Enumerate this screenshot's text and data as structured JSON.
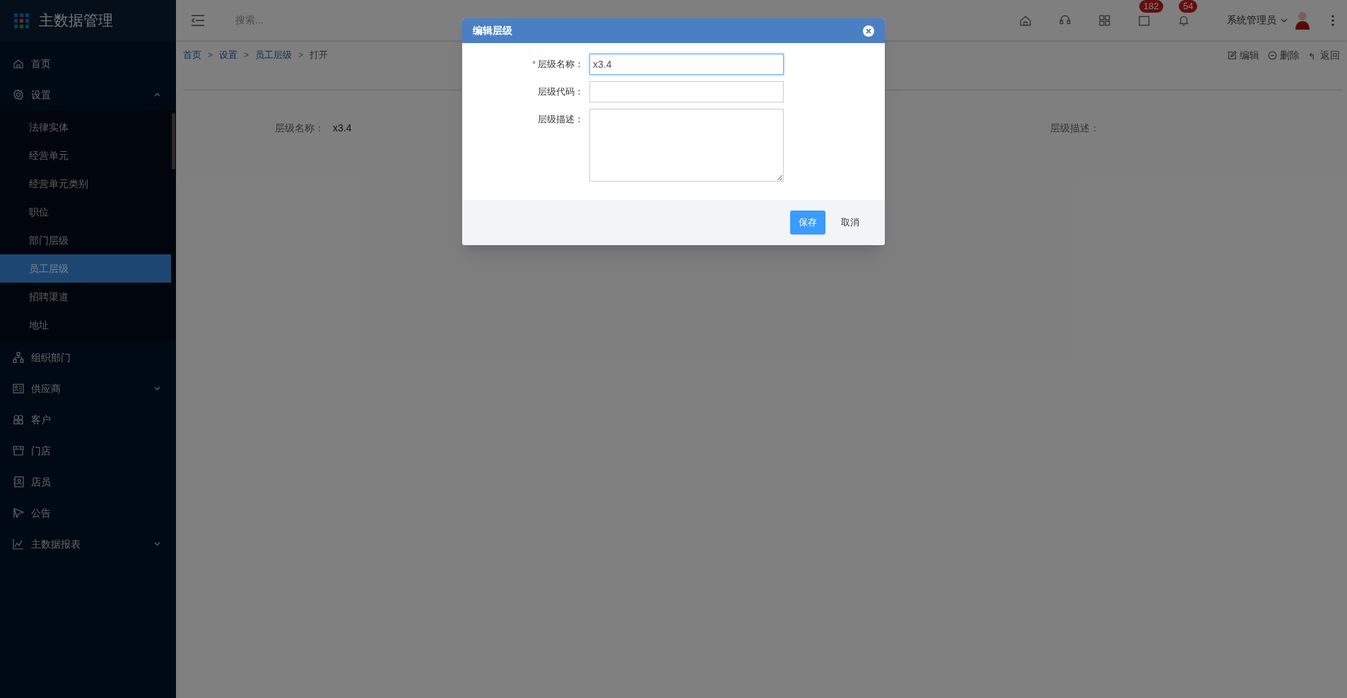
{
  "app": {
    "title": "主数据管理"
  },
  "sidebar": {
    "items": [
      {
        "label": "首页",
        "selected": false
      },
      {
        "label": "设置",
        "selected": false,
        "expanded": true,
        "children": [
          {
            "label": "法律实体",
            "selected": false
          },
          {
            "label": "经营单元",
            "selected": false
          },
          {
            "label": "经营单元类别",
            "selected": false
          },
          {
            "label": "职位",
            "selected": false
          },
          {
            "label": "部门层级",
            "selected": false
          },
          {
            "label": "员工层级",
            "selected": true
          },
          {
            "label": "招聘渠道",
            "selected": false
          },
          {
            "label": "地址",
            "selected": false
          }
        ]
      },
      {
        "label": "组织部门",
        "selected": false
      },
      {
        "label": "供应商",
        "selected": false,
        "expanded": false
      },
      {
        "label": "客户",
        "selected": false
      },
      {
        "label": "门店",
        "selected": false
      },
      {
        "label": "店员",
        "selected": false
      },
      {
        "label": "公告",
        "selected": false
      },
      {
        "label": "主数据报表",
        "selected": false,
        "expanded": false
      }
    ]
  },
  "header": {
    "search": {
      "placeholder": "搜索..."
    },
    "badges": [
      "182",
      "54"
    ],
    "user": "系统管理员"
  },
  "breadcrumb_separator": ">",
  "breadcrumb": [
    {
      "label": "首页",
      "kind": "link"
    },
    {
      "label": "设置",
      "kind": "link"
    },
    {
      "label": "员工层级",
      "kind": "link"
    },
    {
      "label": "打开",
      "kind": "current"
    }
  ],
  "actions": [
    "编辑",
    "删除",
    "返回"
  ],
  "details": [
    {
      "label": "层级名称：",
      "value": "x3.4"
    },
    {
      "label": "层级描述："
    }
  ],
  "dialog": {
    "title": "编辑层级",
    "fields": [
      {
        "label": "层级名称：",
        "required_mark": "*",
        "kind": "input",
        "value": "x3.4",
        "focused": true
      },
      {
        "label": "层级代码：",
        "kind": "input",
        "focused": false
      },
      {
        "label": "层级描述：",
        "kind": "textarea",
        "focused": false
      }
    ],
    "buttons": [
      {
        "label": "保存",
        "kind": "primary"
      },
      {
        "label": "取消",
        "kind": "plain"
      }
    ]
  }
}
